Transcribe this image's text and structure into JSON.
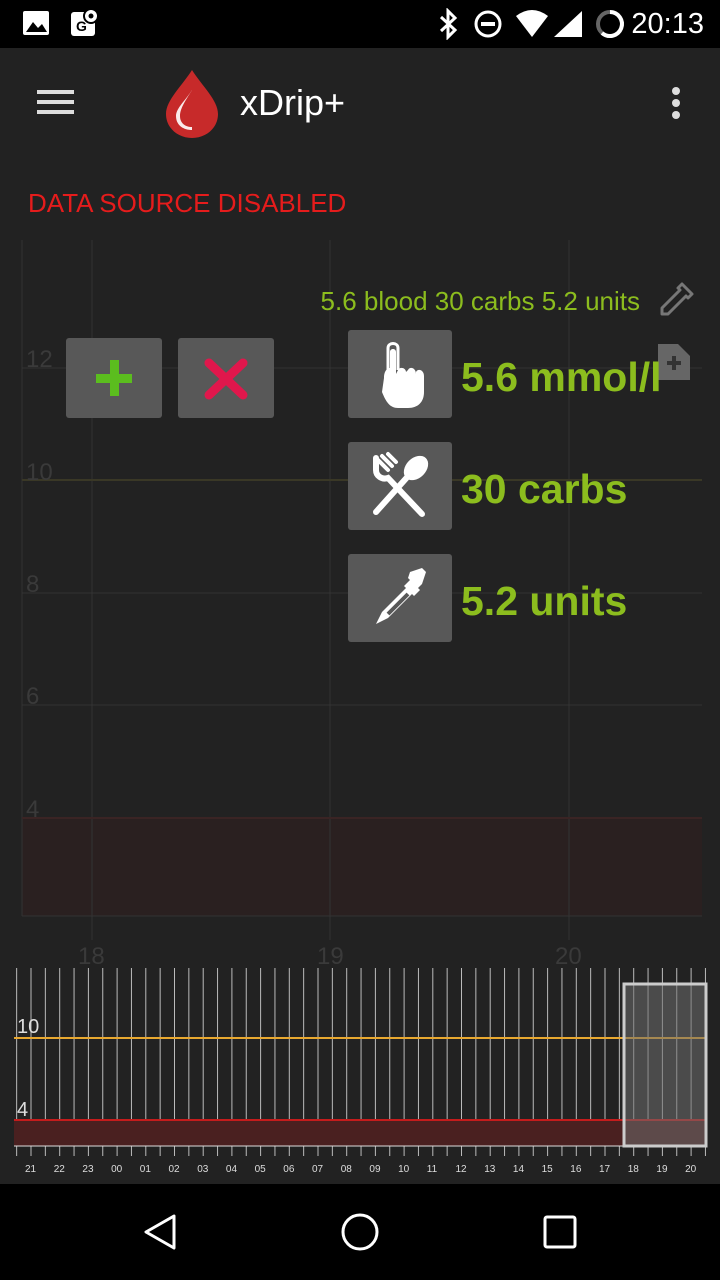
{
  "status_bar": {
    "time": "20:13"
  },
  "toolbar": {
    "title": "xDrip+"
  },
  "main": {
    "error": "DATA SOURCE DISABLED",
    "summary": "5.6 blood 30 carbs 5.2 units",
    "entries": [
      {
        "value": "5.6 mmol/l",
        "icon": "touch-icon"
      },
      {
        "value": "30 carbs",
        "icon": "fork-spoon-icon"
      },
      {
        "value": "5.2 units",
        "icon": "syringe-icon"
      }
    ]
  },
  "chart_data": [
    {
      "type": "line",
      "y_ticks": [
        "12",
        "10",
        "8",
        "6",
        "4"
      ],
      "x_ticks": [
        "18",
        "19",
        "20"
      ],
      "series": []
    },
    {
      "type": "line",
      "y_ticks": [
        "10",
        "4"
      ],
      "x_ticks": [
        "21",
        "22",
        "23",
        "00",
        "01",
        "02",
        "03",
        "04",
        "05",
        "06",
        "07",
        "08",
        "09",
        "10",
        "11",
        "12",
        "13",
        "14",
        "15",
        "16",
        "17",
        "18",
        "19",
        "20"
      ],
      "high_line": 10,
      "low_line": 4,
      "colors": {
        "high": "#e8a830",
        "low": "#c41c1c"
      },
      "series": []
    }
  ]
}
